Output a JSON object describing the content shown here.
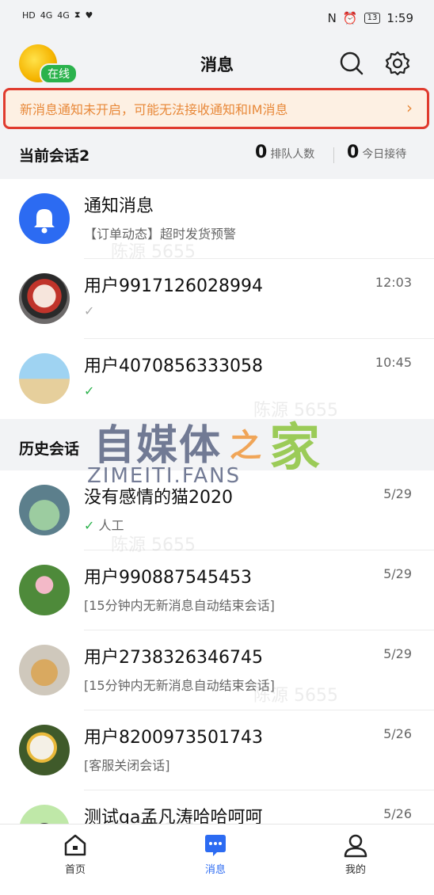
{
  "status_bar": {
    "left_icons": [
      "HD",
      "4G",
      "4G"
    ],
    "time": "1:59",
    "battery": "13"
  },
  "header": {
    "title": "消息",
    "online_badge": "在线"
  },
  "notice": {
    "text": "新消息通知未开启，可能无法接收通知和IM消息",
    "arrow": "›"
  },
  "current_section": {
    "title": "当前会话2",
    "queue_count": "0",
    "queue_label": "排队人数",
    "today_count": "0",
    "today_label": "今日接待"
  },
  "current_sessions": [
    {
      "name": "通知消息",
      "sub": "【订单动态】超时发货预警",
      "time": "",
      "avatar": "bell-icon"
    },
    {
      "name": "用户9917126028994",
      "sub": "✓",
      "time": "12:03",
      "avatar": "opera-face"
    },
    {
      "name": "用户4070856333058",
      "sub": "✓",
      "time": "10:45",
      "avatar": "beach"
    }
  ],
  "history_section": {
    "title": "历史会话"
  },
  "history_sessions": [
    {
      "name": "没有感情的猫2020",
      "sub_check": "✓",
      "sub": "人工",
      "time": "5/29"
    },
    {
      "name": "用户990887545453",
      "sub": "[15分钟内无新消息自动结束会话]",
      "time": "5/29"
    },
    {
      "name": "用户2738326346745",
      "sub": "[15分钟内无新消息自动结束会话]",
      "time": "5/29"
    },
    {
      "name": "用户8200973501743",
      "sub": "[客服关闭会话]",
      "time": "5/26"
    },
    {
      "name": "测试qa孟凡涛哈哈呵呵",
      "sub": "",
      "time": "5/26"
    }
  ],
  "tabbar": {
    "home": "首页",
    "messages": "消息",
    "mine": "我的"
  },
  "watermark": {
    "text": "陈源 5655",
    "brand_cn": "自媒体",
    "brand_zhi": "之",
    "brand_jia": "家",
    "brand_en": "ZIMEITI.FANS"
  },
  "colors": {
    "accent": "#2c6bf2",
    "online": "#2bb24c",
    "notice_text": "#e8893a",
    "notice_border": "#e03b2e"
  }
}
